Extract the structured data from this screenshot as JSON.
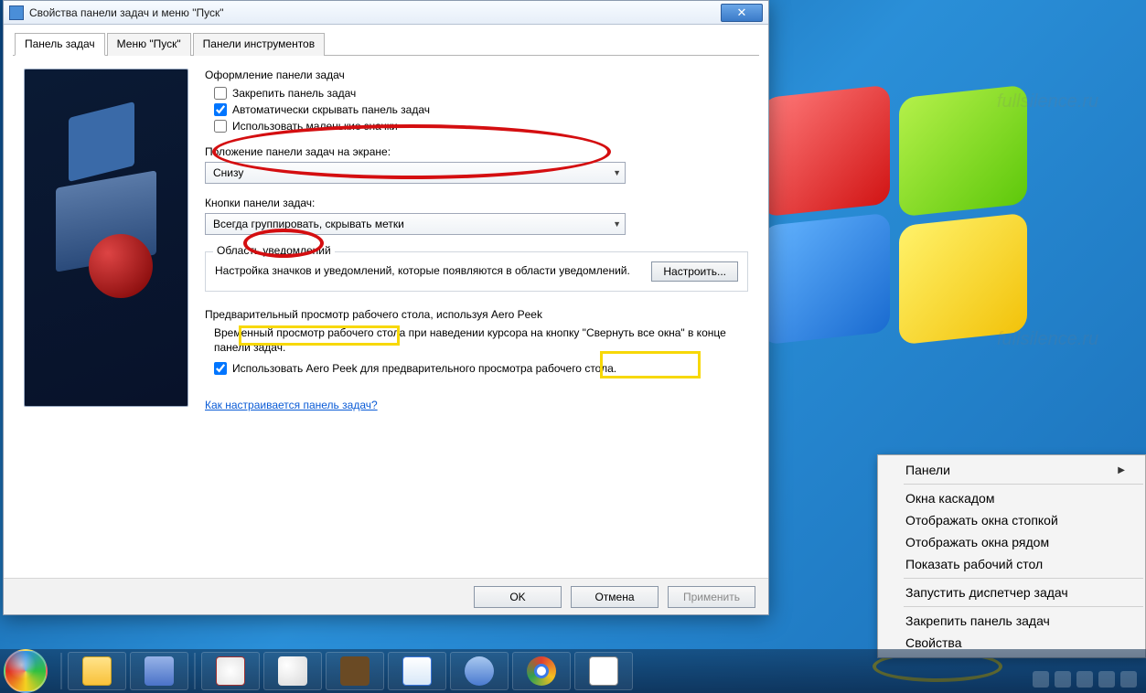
{
  "watermark": "fullsilence.ru",
  "dialog": {
    "title": "Свойства панели задач и меню \"Пуск\"",
    "tabs": [
      "Панель задач",
      "Меню \"Пуск\"",
      "Панели инструментов"
    ],
    "appearance": {
      "title": "Оформление панели задач",
      "lock": "Закрепить панель задач",
      "autohide": "Автоматически скрывать панель задач",
      "small_icons": "Использовать маленькие значки"
    },
    "position": {
      "label": "Положение панели задач на экране:",
      "value": "Снизу"
    },
    "buttons_combo": {
      "label": "Кнопки панели задач:",
      "value": "Всегда группировать, скрывать метки"
    },
    "notify": {
      "legend": "Область уведомлений",
      "text": "Настройка значков и уведомлений, которые появляются в области уведомлений.",
      "btn": "Настроить..."
    },
    "aero": {
      "title": "Предварительный просмотр рабочего стола, используя Aero Peek",
      "desc": "Временный просмотр рабочего стола при наведении курсора на кнопку \"Свернуть все окна\" в конце панели задач.",
      "chk": "Использовать Aero Peek для предварительного просмотра рабочего стола."
    },
    "help_link": "Как настраивается панель задач?",
    "ok": "OK",
    "cancel": "Отмена",
    "apply": "Применить"
  },
  "ctx": {
    "items": [
      {
        "label": "Панели",
        "sub": true
      },
      {
        "sep": true
      },
      {
        "label": "Окна каскадом"
      },
      {
        "label": "Отображать окна стопкой"
      },
      {
        "label": "Отображать окна рядом"
      },
      {
        "label": "Показать рабочий стол"
      },
      {
        "sep": true
      },
      {
        "label": "Запустить диспетчер задач"
      },
      {
        "sep": true
      },
      {
        "label": "Закрепить панель задач"
      },
      {
        "label": "Свойства"
      }
    ]
  }
}
